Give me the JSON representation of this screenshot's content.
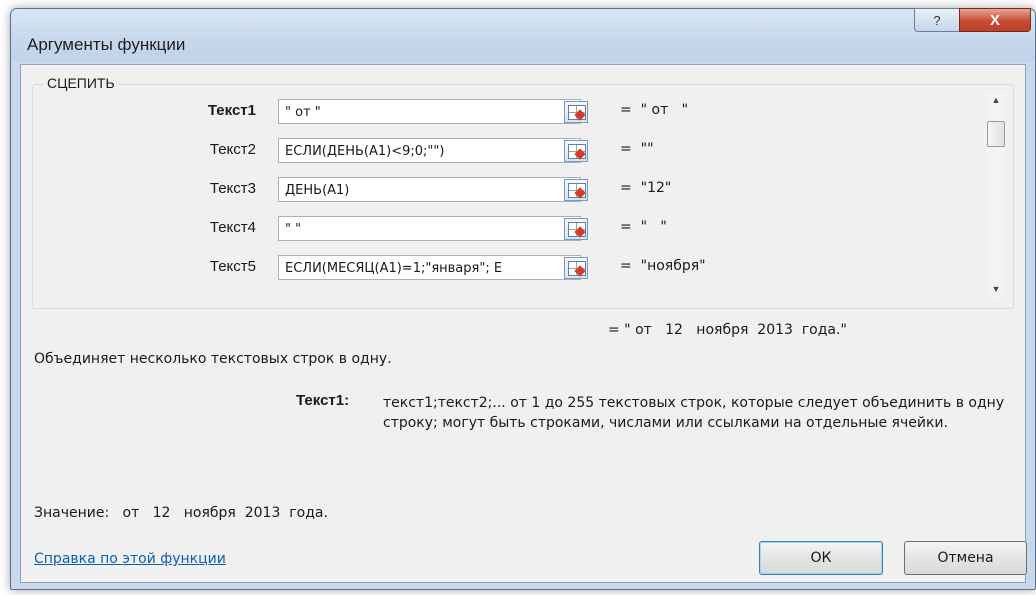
{
  "window": {
    "title": "Аргументы функции",
    "help_glyph": "?",
    "close_glyph": "X"
  },
  "function_group": {
    "name": "СЦЕПИТЬ",
    "args": [
      {
        "label": "Текст1",
        "input": "\" от   \"",
        "value": "\" от   \""
      },
      {
        "label": "Текст2",
        "input": "ЕСЛИ(ДЕНЬ(A1)<9;0;\"\")",
        "value": "\"\""
      },
      {
        "label": "Текст3",
        "input": "ДЕНЬ(A1)",
        "value": "\"12\""
      },
      {
        "label": "Текст4",
        "input": "\"   \"",
        "value": "\"   \""
      },
      {
        "label": "Текст5",
        "input": "ЕСЛИ(МЕСЯЦ(A1)=1;\"января\"; Е",
        "value": "\"ноября\""
      }
    ],
    "equals": "=",
    "scroll_up_icon": "▲",
    "scroll_down_icon": "▼"
  },
  "result": "= \" от   12   ноября  2013  года.\"",
  "description": "Объединяет несколько текстовых строк в одну.",
  "arg_help": {
    "name": "Текст1:",
    "text": "текст1;текст2;... от 1 до 255 текстовых строк, которые следует объединить в одну строку; могут быть строками, числами или ссылками на отдельные ячейки."
  },
  "value_line": "Значение:   от   12   ноября  2013  года.",
  "help_link": "Справка по этой функции",
  "buttons": {
    "ok": "ОК",
    "cancel": "Отмена"
  },
  "colors": {
    "titlebar": "#c7d8ed",
    "close": "#c84b31",
    "link": "#0d5fb3"
  }
}
